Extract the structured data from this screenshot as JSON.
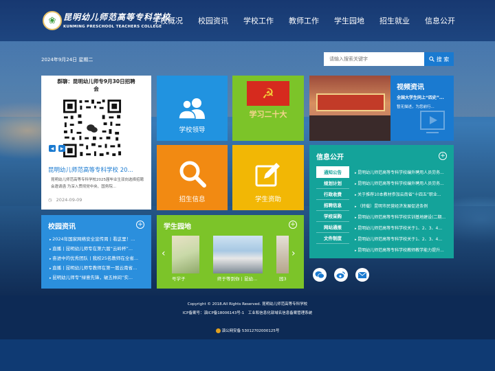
{
  "header": {
    "logo_cn": "昆明幼儿师范高等专科学校",
    "logo_en": "KUNMING PRESCHOOL TEACHERS COLLEGE",
    "nav": [
      "学校概况",
      "校园资讯",
      "学校工作",
      "教师工作",
      "学生园地",
      "招生就业",
      "信息公开"
    ]
  },
  "date": "2024年9月24日 星期二",
  "search": {
    "placeholder": "请输入搜索关键字",
    "button": "搜 索"
  },
  "wechat": {
    "title": "群聊：昆明幼儿师专9月30日招聘会",
    "news_title": "昆明幼儿师范高等专科学校 20...",
    "news_summary": "昆明幼儿师范高等专科学校2025届毕业生双向选择招聘会邀请函 为深入贯彻党中央、国务院...",
    "news_date": "2024-09-09"
  },
  "tiles": {
    "leader": "学校领导",
    "study": "学习二十大",
    "recruit": "招生信息",
    "aid": "学生资助"
  },
  "video": {
    "title": "视频资讯",
    "subtitle": "全国大学生同上“四史”...",
    "summary": "暂无描述，为您前行..."
  },
  "info": {
    "title": "信息公开",
    "tabs": [
      "通知公告",
      "规划计划",
      "行政收费",
      "招聘信息",
      "学校采购",
      "网站通报",
      "文件制度"
    ],
    "items": [
      "昆明幼儿师范高等专科学校编外聘用人员劳务...",
      "昆明幼儿师范高等专科学校编外聘用人员劳务...",
      "关于推荐10本教材参加云南省“十四五”职业...",
      "（转载）昆明市民营经济发展促进条例",
      "昆明幼儿师范高等专科学校实训基地建设(二期...",
      "昆明幼儿师范高等专科学校关于1、2、3、4...",
      "昆明幼儿师范高等专科学校关于1、2、3、4...",
      "昆明幼儿师范高等专科学校教师教学能力提升..."
    ]
  },
  "campus": {
    "title": "校园资讯",
    "items": [
      "2024年国家网络安全宣传周丨看这里！...",
      "直播丨昆明幼儿师专在第六届“云岭杯”...",
      "奋进中的优秀团队丨我校25名教师在全省...",
      "直播丨昆明幼儿师专教师在第一届云南省...",
      "昆明幼儿师专“绿意先锋，破五林间”实..."
    ]
  },
  "garden": {
    "title": "学生园地",
    "captions": [
      "号学子",
      "终于等到你丨昆幼...",
      "园3"
    ]
  },
  "footer": {
    "copyright": "Copyright © 2018.All Rights Reserved. 昆明幼儿师范高等专科学校",
    "icp": "ICP备案号：滇ICP备18006143号-1　工业和信息化部域名信息备案管理系统",
    "police": "滇公网安备 53012702000125号"
  },
  "colors": {
    "blue": "#2193e0",
    "green": "#7cc429",
    "orange": "#f28a12",
    "yellow": "#f2b705",
    "teal": "#14a39a",
    "navy": "#0d2a55"
  }
}
